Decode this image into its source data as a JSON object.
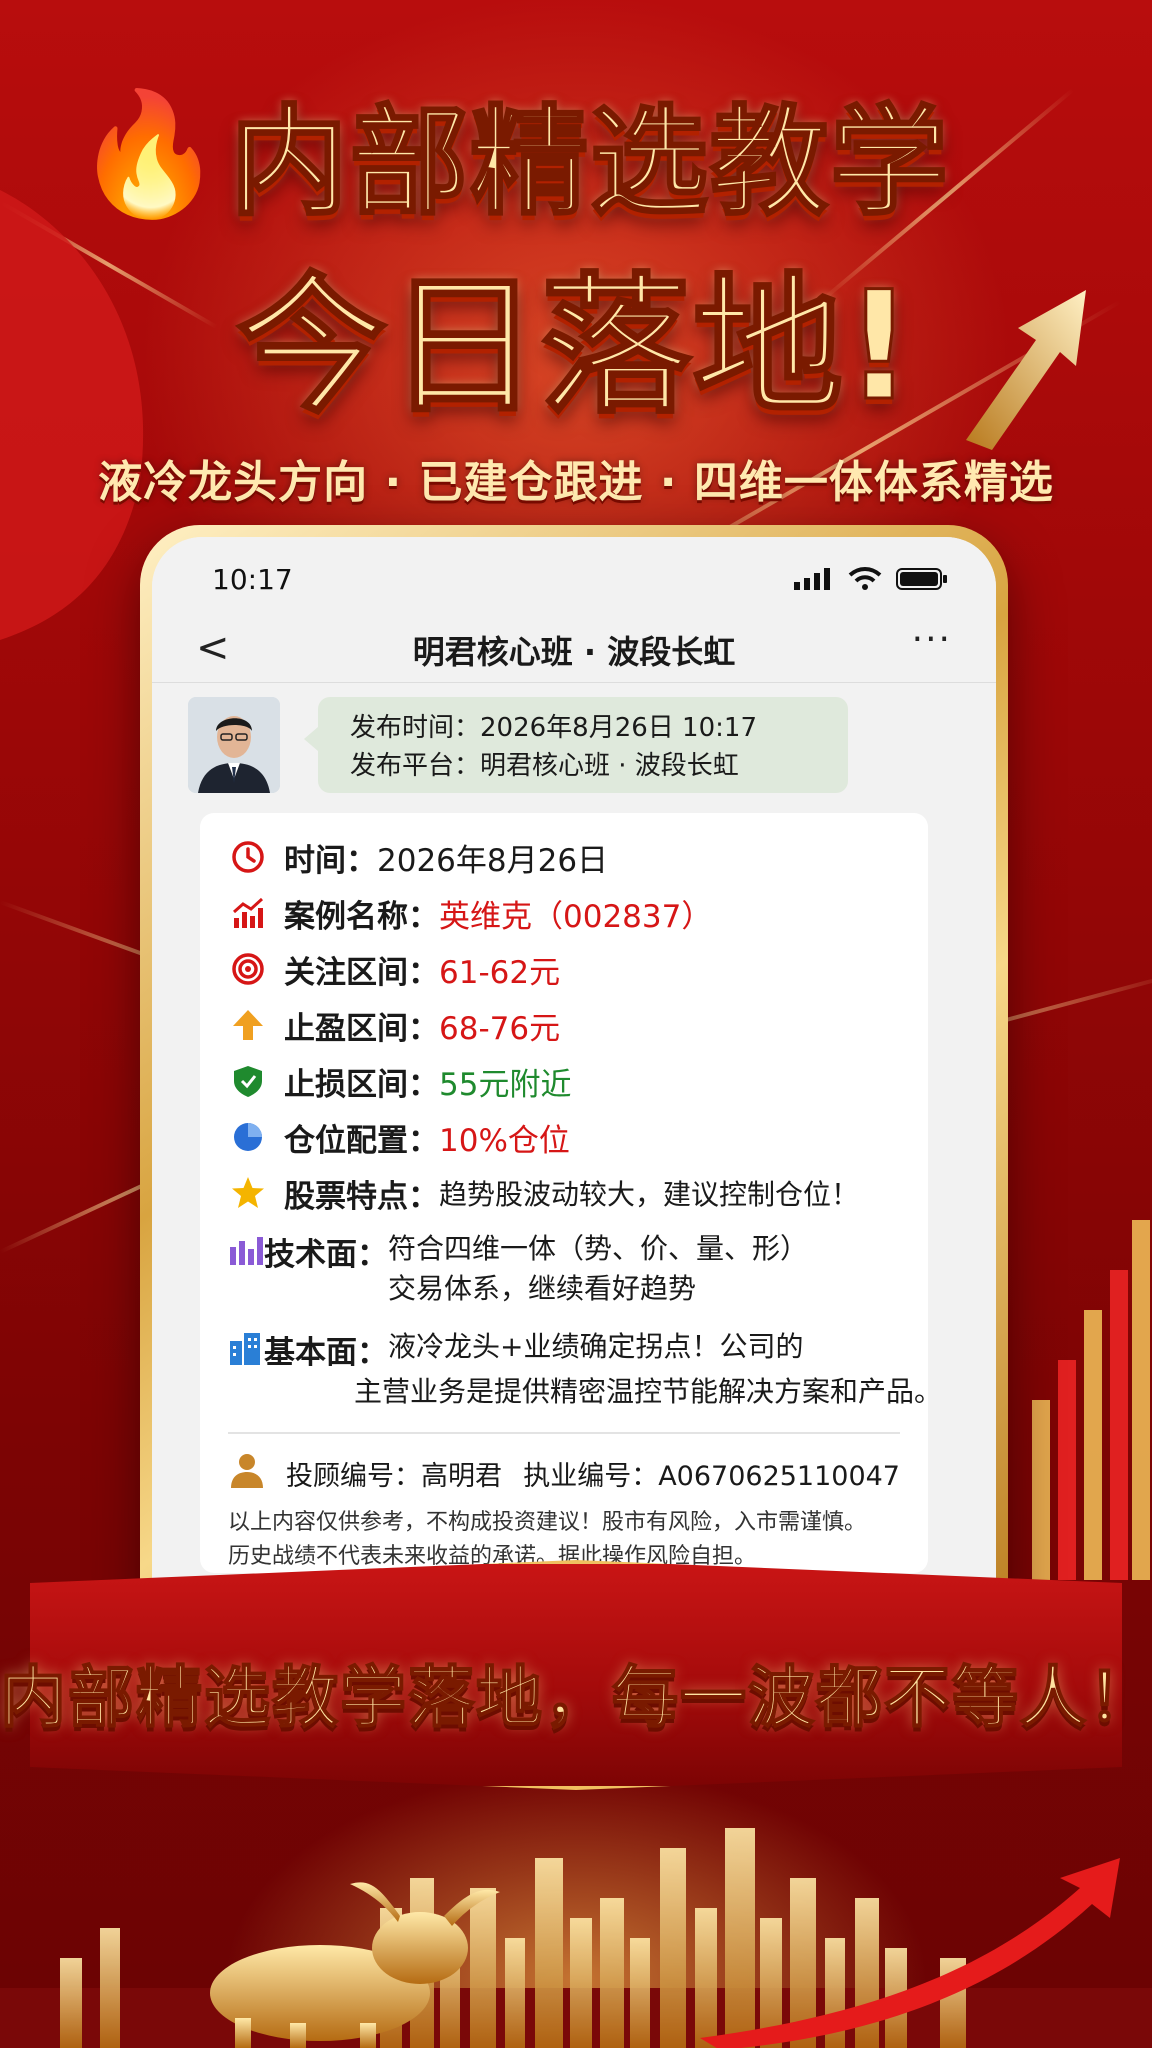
{
  "headline": {
    "line1": "内部精选教学",
    "line2": "今日落地!",
    "subtitle": "液冷龙头方向 · 已建仓跟进 · 四维一体体系精选",
    "fire_icon": "🔥"
  },
  "phone": {
    "status_time": "10:17",
    "nav_back": "<",
    "nav_title": "明君核心班 · 波段长虹",
    "nav_more": "···",
    "message": {
      "publish_time": "发布时间：2026年8月26日 10:17",
      "publish_platform": "发布平台：明君核心班 · 波段长虹"
    },
    "card": {
      "time_label": "时间：",
      "time_value": "2026年8月26日",
      "case_label": "案例名称：",
      "case_value": "英维克（002837）",
      "focus_label": "关注区间：",
      "focus_value": "61-62元",
      "take_profit_label": "止盈区间：",
      "take_profit_value": "68-76元",
      "stop_loss_label": "止损区间：",
      "stop_loss_value": "55元附近",
      "position_label": "仓位配置：",
      "position_value": "10%仓位",
      "feature_label": "股票特点：",
      "feature_value": "趋势股波动较大，建议控制仓位！",
      "tech_label": "技术面：",
      "tech_line1": "符合四维一体（势、价、量、形）",
      "tech_line2": "交易体系，继续看好趋势",
      "fund_label": "基本面：",
      "fund_line1": "液冷龙头+业绩确定拐点！公司的",
      "fund_line2": "主营业务是提供精密温控节能解决方案和产品。",
      "advisor": "投顾编号：高明君",
      "license": "执业编号：A0670625110047",
      "disclaimer1": "以上内容仅供参考，不构成投资建议！股市有风险，入市需谨慎。",
      "disclaimer2": "历史战绩不代表未来收益的承诺。据此操作风险自担。"
    }
  },
  "banner": {
    "text": "内部精选教学落地，每一波都不等人！"
  },
  "colors": {
    "red_value": "#d61616",
    "green_value": "#1f8a2e",
    "gold": "#ffe3a0",
    "bg_red": "#9c0707"
  }
}
